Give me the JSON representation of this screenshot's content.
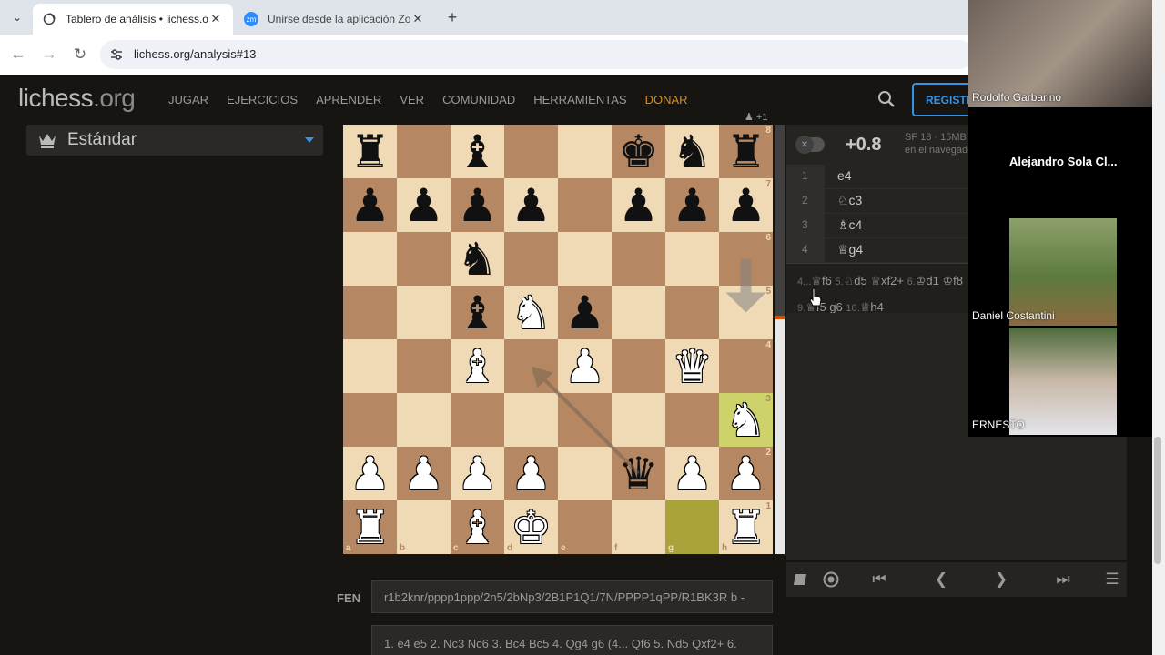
{
  "browser": {
    "tabs": [
      {
        "title": "Tablero de análisis • lichess.org",
        "active": true
      },
      {
        "title": "Unirse desde la aplicación Zoom",
        "active": false
      }
    ],
    "url": "lichess.org/analysis#13"
  },
  "site": {
    "logo_main": "lichess",
    "logo_tld": ".org",
    "nav": [
      "JUGAR",
      "EJERCICIOS",
      "APRENDER",
      "VER",
      "COMUNIDAD",
      "HERRAMIENTAS"
    ],
    "donate": "DONAR",
    "signup": "REGISTRARSE"
  },
  "variant": {
    "label": "Estándar"
  },
  "board": {
    "players_online": "+1",
    "ranks": [
      "8",
      "7",
      "6",
      "5",
      "4",
      "3",
      "2",
      "1"
    ],
    "files": [
      "a",
      "b",
      "c",
      "d",
      "e",
      "f",
      "g",
      "h"
    ],
    "position": [
      [
        "r",
        "",
        "b",
        "",
        "",
        "k",
        "n",
        "r"
      ],
      [
        "p",
        "p",
        "p",
        "p",
        "",
        "p",
        "p",
        "p"
      ],
      [
        "",
        "",
        "n",
        "",
        "",
        "",
        "",
        ""
      ],
      [
        "",
        "",
        "b",
        "N",
        "p",
        "",
        "",
        ""
      ],
      [
        "",
        "",
        "B",
        "",
        "P",
        "",
        "Q",
        ""
      ],
      [
        "",
        "",
        "",
        "",
        "",
        "",
        "",
        "N"
      ],
      [
        "P",
        "P",
        "P",
        "P",
        "",
        "q",
        "P",
        "P"
      ],
      [
        "R",
        "",
        "B",
        "K",
        "",
        "",
        "",
        "R"
      ]
    ],
    "last_move": [
      "g1",
      "h3"
    ],
    "arrows": [
      {
        "from": "h6",
        "to": "h5"
      },
      {
        "from": "f2",
        "to": "d4"
      }
    ],
    "eval_white_fraction": 0.55
  },
  "ceval": {
    "score": "+0.8",
    "engine": "SF 18 · 15MB",
    "location": "en el navegador"
  },
  "moves": [
    {
      "num": "1",
      "san": "e4"
    },
    {
      "num": "2",
      "san": "♘c3"
    },
    {
      "num": "3",
      "san": "♗c4"
    },
    {
      "num": "4",
      "san": "♕g4"
    }
  ],
  "variation": {
    "line1": [
      {
        "n": "4...",
        "m": "♕f6"
      },
      {
        "n": "5.",
        "m": "♘d5"
      },
      {
        "n": "",
        "m": "♕xf2+"
      },
      {
        "n": "6.",
        "m": "♔d1"
      },
      {
        "n": "",
        "m": "♔f8"
      }
    ],
    "line2": [
      {
        "n": "9.",
        "m": "♕f5"
      },
      {
        "n": "",
        "m": "g6"
      },
      {
        "n": "10.",
        "m": "♕h4"
      }
    ]
  },
  "fen": {
    "label": "FEN",
    "value": "r1b2knr/pppp1ppp/2n5/2bNp3/2B1P1Q1/7N/PPPP1qPP/R1BK3R b -"
  },
  "pgn": {
    "value": "1. e4 e5 2. Nc3 Nc6 3. Bc4 Bc5 4. Qg4 g6 (4... Qf6 5. Nd5 Qxf2+ 6."
  },
  "zoom": {
    "participants": [
      {
        "name": "Rodolfo Garbarino"
      },
      {
        "name": "Alejandro Sola Cl..."
      },
      {
        "name": "Daniel Costantini"
      },
      {
        "name": "ERNESTO"
      }
    ]
  },
  "colors": {
    "background": "#161512",
    "board_light": "#f0d9b5",
    "board_dark": "#b58863",
    "accent_blue": "#3692e7",
    "donate": "#d59020"
  }
}
